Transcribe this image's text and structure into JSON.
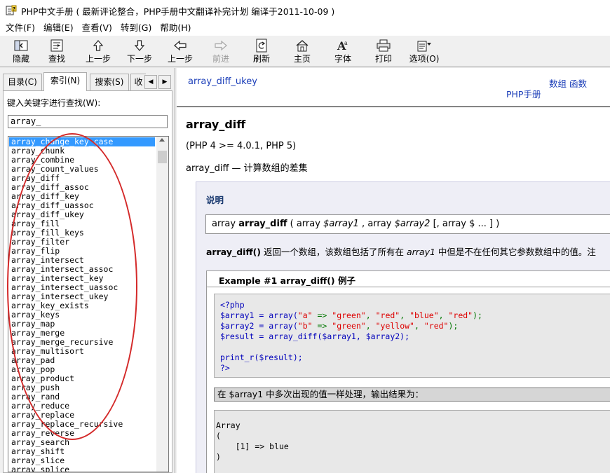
{
  "window": {
    "title": "PHP中文手册 ( 最新评论整合，PHP手册中文翻译补完计划 编译于2011-10-09 )"
  },
  "menu": [
    "文件(F)",
    "编辑(E)",
    "查看(V)",
    "转到(G)",
    "帮助(H)"
  ],
  "toolbar": {
    "buttons": [
      {
        "label": "隐藏",
        "icon": "hide-icon"
      },
      {
        "label": "查找",
        "icon": "locate-icon"
      },
      {
        "label": "上一步",
        "icon": "up-arrow-icon"
      },
      {
        "label": "下一步",
        "icon": "down-arrow-icon"
      },
      {
        "label": "上一步",
        "icon": "back-arrow-icon"
      },
      {
        "label": "前进",
        "icon": "forward-arrow-icon"
      },
      {
        "label": "刷新",
        "icon": "refresh-icon"
      },
      {
        "label": "主页",
        "icon": "home-icon"
      },
      {
        "label": "字体",
        "icon": "font-icon"
      },
      {
        "label": "打印",
        "icon": "printer-icon"
      },
      {
        "label": "选项(O)",
        "icon": "options-icon"
      }
    ]
  },
  "sidebar": {
    "tabs": [
      "目录(C)",
      "索引(N)",
      "搜索(S)",
      "收"
    ],
    "active_tab": "索引(N)",
    "search_label": "键入关键字进行查找(W):",
    "search_value": "array_",
    "items": [
      "array_change_key_case",
      "array_chunk",
      "array_combine",
      "array_count_values",
      "array_diff",
      "array_diff_assoc",
      "array_diff_key",
      "array_diff_uassoc",
      "array_diff_ukey",
      "array_fill",
      "array_fill_keys",
      "array_filter",
      "array_flip",
      "array_intersect",
      "array_intersect_assoc",
      "array_intersect_key",
      "array_intersect_uassoc",
      "array_intersect_ukey",
      "array_key_exists",
      "array_keys",
      "array_map",
      "array_merge",
      "array_merge_recursive",
      "array_multisort",
      "array_pad",
      "array_pop",
      "array_product",
      "array_push",
      "array_rand",
      "array_reduce",
      "array_replace",
      "array_replace_recursive",
      "array_reverse",
      "array_search",
      "array_shift",
      "array_slice",
      "array_splice"
    ],
    "selected_index": 0,
    "annotation_color": "#d42a2a"
  },
  "content": {
    "nav": {
      "prev": "array_diff_ukey",
      "links": [
        "数组",
        "函数"
      ],
      "home": "PHP手册"
    },
    "refname": "array_diff",
    "version": "(PHP 4 >= 4.0.1, PHP 5)",
    "purpose": "array_diff — 计算数组的差集",
    "description": {
      "title": "说明",
      "signature": {
        "return_type": "array",
        "name": "array_diff",
        "open": "(",
        "p1_type": "array",
        "p1_name": "$array1",
        "p2_type": "array",
        "p2_name": "$array2",
        "rest": "[, array $ ... ] )"
      },
      "text_fn": "array_diff()",
      "text_1": "返回一个数组，该数组包括了所有在",
      "text_param": "array1",
      "text_2": "中但是不在任何其它参数数组中的值。注"
    },
    "example": {
      "title": "Example #1 array_diff() 例子",
      "code": {
        "line1": "<?php",
        "line2": {
          "a": "$array1 = array(",
          "b": "\"a\"",
          "c": " => ",
          "d": "\"green\"",
          "e": ", ",
          "f": "\"red\"",
          "g": ", ",
          "h": "\"blue\"",
          "i": ", ",
          "j": "\"red\"",
          "k": ");"
        },
        "line3": {
          "a": "$array2 = array(",
          "b": "\"b\"",
          "c": " => ",
          "d": "\"green\"",
          "e": ", ",
          "f": "\"yellow\"",
          "g": ", ",
          "h": "\"red\"",
          "i": ");"
        },
        "line4": "$result = array_diff($array1, $array2);",
        "line5": "",
        "line6": "print_r($result);",
        "line7": "?>"
      },
      "note": "在 $array1 中多次出现的值一样处理，输出结果为：",
      "output": [
        "",
        "Array",
        "(",
        "    [1] => blue",
        ")"
      ]
    }
  }
}
